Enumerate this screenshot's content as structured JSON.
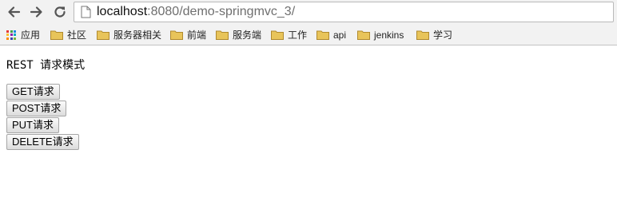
{
  "browser": {
    "url_host": "localhost",
    "url_rest": ":8080/demo-springmvc_3/",
    "icons": {
      "back": "back-arrow-icon",
      "forward": "forward-arrow-icon",
      "reload": "reload-icon",
      "page": "page-icon"
    }
  },
  "bookmarks": [
    {
      "label": "应用",
      "icon": "apps-icon"
    },
    {
      "label": "社区",
      "icon": "folder-icon"
    },
    {
      "label": "服务器相关",
      "icon": "folder-icon"
    },
    {
      "label": "前端",
      "icon": "folder-icon"
    },
    {
      "label": "服务端",
      "icon": "folder-icon"
    },
    {
      "label": "工作",
      "icon": "folder-icon"
    },
    {
      "label": "api",
      "icon": "folder-icon"
    },
    {
      "label": "jenkins",
      "icon": "folder-icon"
    },
    {
      "label": "学习",
      "icon": "folder-icon"
    }
  ],
  "colors": {
    "folder": "#e8c45a",
    "apps_grid": [
      "#e53935",
      "#43a047",
      "#1e88e5",
      "#fbc02d",
      "#8e24aa",
      "#00acc1",
      "#fb8c00",
      "#3949ab",
      "#7cb342"
    ]
  },
  "page": {
    "title": "REST 请求模式",
    "buttons": [
      "GET请求",
      "POST请求",
      "PUT请求",
      "DELETE请求"
    ]
  }
}
